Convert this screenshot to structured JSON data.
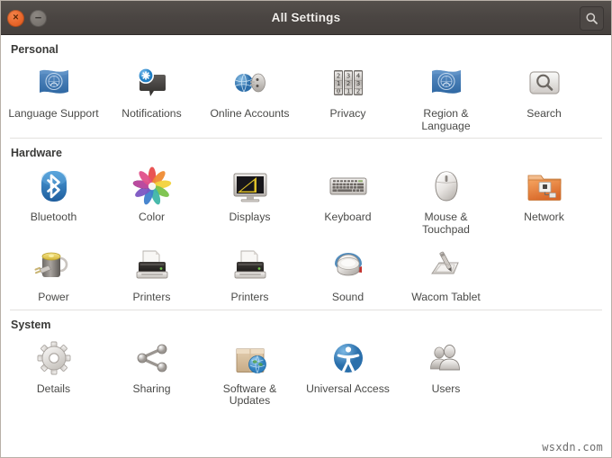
{
  "window": {
    "title": "All Settings",
    "close_label": "×",
    "minimize_label": "−",
    "close_color": "#e8662a",
    "minimize_color": "#7b7671",
    "titlebar_color": "#4a4542",
    "search_button_name": "search-icon"
  },
  "watermark": "wsxdn.com",
  "sections": [
    {
      "id": "personal",
      "title": "Personal",
      "divider_above": false,
      "rows": [
        [
          {
            "label": "Language Support",
            "icon": "flag-icon"
          },
          {
            "label": "Notifications",
            "icon": "notification-bubble-icon"
          },
          {
            "label": "Online Accounts",
            "icon": "online-accounts-icon"
          },
          {
            "label": "Privacy",
            "icon": "combination-lock-icon"
          },
          {
            "label": "Region & Language",
            "icon": "flag-icon"
          },
          {
            "label": "Search",
            "icon": "magnifier-icon"
          }
        ]
      ]
    },
    {
      "id": "hardware",
      "title": "Hardware",
      "divider_above": true,
      "rows": [
        [
          {
            "label": "Bluetooth",
            "icon": "bluetooth-icon"
          },
          {
            "label": "Color",
            "icon": "color-wheel-icon"
          },
          {
            "label": "Displays",
            "icon": "monitor-icon"
          },
          {
            "label": "Keyboard",
            "icon": "keyboard-icon"
          },
          {
            "label": "Mouse & Touchpad",
            "icon": "mouse-icon"
          },
          {
            "label": "Network",
            "icon": "network-folder-icon"
          }
        ],
        [
          {
            "label": "Power",
            "icon": "power-plug-icon"
          },
          {
            "label": "Printers",
            "icon": "printer-icon"
          },
          {
            "label": "Printers",
            "icon": "printer-icon"
          },
          {
            "label": "Sound",
            "icon": "speaker-icon"
          },
          {
            "label": "Wacom Tablet",
            "icon": "tablet-stylus-icon"
          }
        ]
      ]
    },
    {
      "id": "system",
      "title": "System",
      "divider_above": true,
      "rows": [
        [
          {
            "label": "Details",
            "icon": "gear-icon"
          },
          {
            "label": "Sharing",
            "icon": "share-nodes-icon"
          },
          {
            "label": "Software & Updates",
            "icon": "package-globe-icon"
          },
          {
            "label": "Universal Access",
            "icon": "accessibility-icon"
          },
          {
            "label": "Users",
            "icon": "users-icon"
          }
        ]
      ]
    }
  ]
}
